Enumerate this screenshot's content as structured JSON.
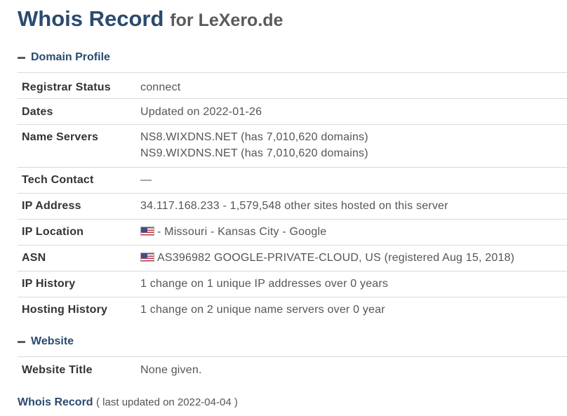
{
  "header": {
    "title": "Whois Record",
    "subtitle": "for LeXero.de"
  },
  "domain_profile": {
    "heading": "Domain Profile",
    "rows": [
      {
        "label": "Registrar Status",
        "values": [
          "connect"
        ]
      },
      {
        "label": "Dates",
        "values": [
          "Updated on 2022-01-26"
        ]
      },
      {
        "label": "Name Servers",
        "values": [
          "NS8.WIXDNS.NET (has 7,010,620 domains)",
          "NS9.WIXDNS.NET (has 7,010,620 domains)"
        ]
      },
      {
        "label": "Tech Contact",
        "values": [
          "—"
        ]
      },
      {
        "label": "IP Address",
        "values": [
          "34.117.168.233 - 1,579,548 other sites hosted on this server"
        ]
      },
      {
        "label": "IP Location",
        "values": [
          "- Missouri - Kansas City - Google"
        ],
        "flag": "us-flag-icon"
      },
      {
        "label": "ASN",
        "values": [
          "AS396982 GOOGLE-PRIVATE-CLOUD, US (registered Aug 15, 2018)"
        ],
        "flag": "us-flag-icon"
      },
      {
        "label": "IP History",
        "values": [
          "1 change on 1 unique IP addresses over 0 years"
        ]
      },
      {
        "label": "Hosting History",
        "values": [
          "1 change on 2 unique name servers over 0 year"
        ]
      }
    ]
  },
  "website": {
    "heading": "Website",
    "rows": [
      {
        "label": "Website Title",
        "values": [
          "None given."
        ]
      }
    ]
  },
  "footer": {
    "link": "Whois Record",
    "note": "( last updated on 2022-04-04 )"
  },
  "colors": {
    "heading": "#2b4a6f",
    "text": "#555555",
    "border": "#d9d9d9"
  }
}
